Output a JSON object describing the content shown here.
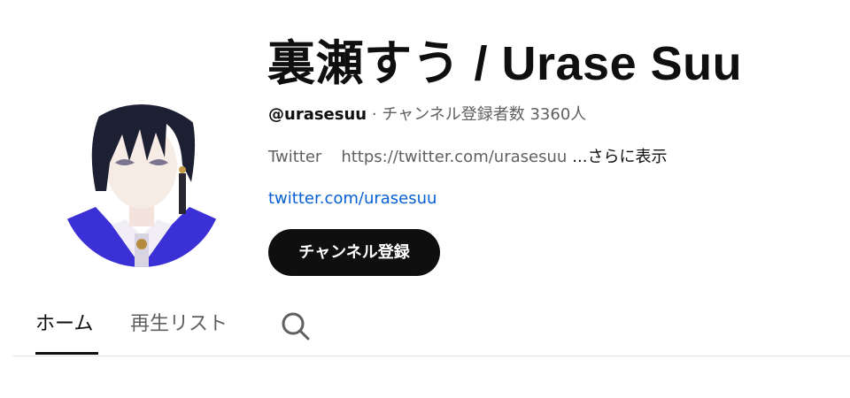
{
  "channel": {
    "title": "裏瀬すう / Urase Suu",
    "handle": "@urasesuu",
    "separator": " · ",
    "subscribers": "チャンネル登録者数 3360人",
    "description_label": "Twitter",
    "description_url": "https://twitter.com/urasesuu",
    "more_label": "...さらに表示",
    "link_text": "twitter.com/urasesuu",
    "subscribe_label": "チャンネル登録"
  },
  "tabs": [
    {
      "label": "ホーム",
      "active": true
    },
    {
      "label": "再生リスト",
      "active": false
    }
  ],
  "icons": {
    "search": "search-icon",
    "avatar": "avatar"
  },
  "colors": {
    "link": "#065fd4",
    "button_bg": "#0f0f0f",
    "secondary_text": "#606060"
  }
}
